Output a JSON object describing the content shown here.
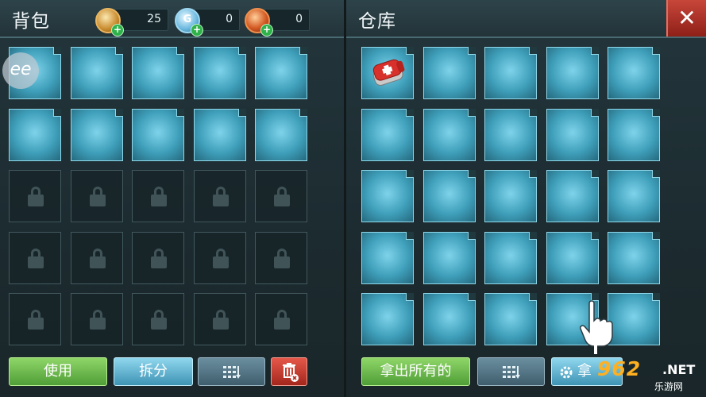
{
  "bag": {
    "title": "背包",
    "currencies": [
      {
        "icon": "gold-coin-icon",
        "value": "25",
        "color": "#d8a24a"
      },
      {
        "icon": "blue-gem-coin-icon",
        "glyph": "G",
        "value": "0",
        "color": "#6ab9df"
      },
      {
        "icon": "red-medal-coin-icon",
        "value": "0",
        "color": "#d4572a"
      }
    ],
    "open_slots": 10,
    "locked_slots": 15,
    "buttons": {
      "use": "使用",
      "split": "拆分"
    }
  },
  "warehouse": {
    "title": "仓库",
    "slots": 25,
    "items": [
      {
        "slot": 0,
        "icon": "medkit-icon",
        "name": "医疗包"
      }
    ],
    "buttons": {
      "take_all": "拿出所有的",
      "take": "拿"
    }
  },
  "close_label": "✕",
  "overlay": {
    "bubble": "ee"
  },
  "watermark": {
    "number": "962",
    "suffix": ".NET",
    "subtitle": "乐游网"
  },
  "colors": {
    "slot_open": "#5fbad4",
    "btn_green": "#6cbc4f",
    "btn_blue": "#63b5d3",
    "btn_red": "#c43a2c"
  }
}
